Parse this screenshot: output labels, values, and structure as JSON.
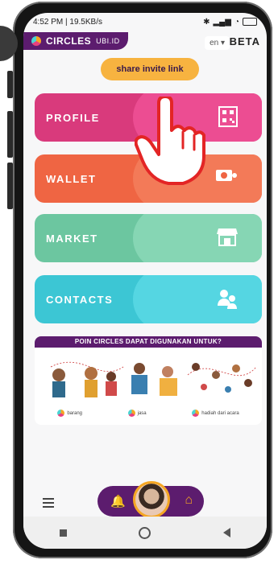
{
  "status_bar": {
    "time_speed": "4:52 PM | 19.5KB/s"
  },
  "header": {
    "logo_text": "CIRCLES",
    "logo_suffix": "UBI.ID",
    "language": "en",
    "beta": "BETA"
  },
  "share_button": "share invite link",
  "cards": [
    {
      "label": "PROFILE",
      "icon": "qr-code-icon"
    },
    {
      "label": "WALLET",
      "icon": "wallet-icon"
    },
    {
      "label": "MARKET",
      "icon": "store-icon"
    },
    {
      "label": "CONTACTS",
      "icon": "people-icon"
    }
  ],
  "banner": {
    "title": "POIN CIRCLES DAPAT DIGUNAKAN UNTUK?",
    "captions": [
      "barang",
      "jasa",
      "hadiah dari acara"
    ]
  },
  "colors": {
    "brand_purple": "#5c1c6e",
    "accent_orange": "#f7b340",
    "profile": "#d93a7c",
    "wallet": "#ef6543",
    "market": "#6cc6a0",
    "contacts": "#3cc6d4"
  }
}
